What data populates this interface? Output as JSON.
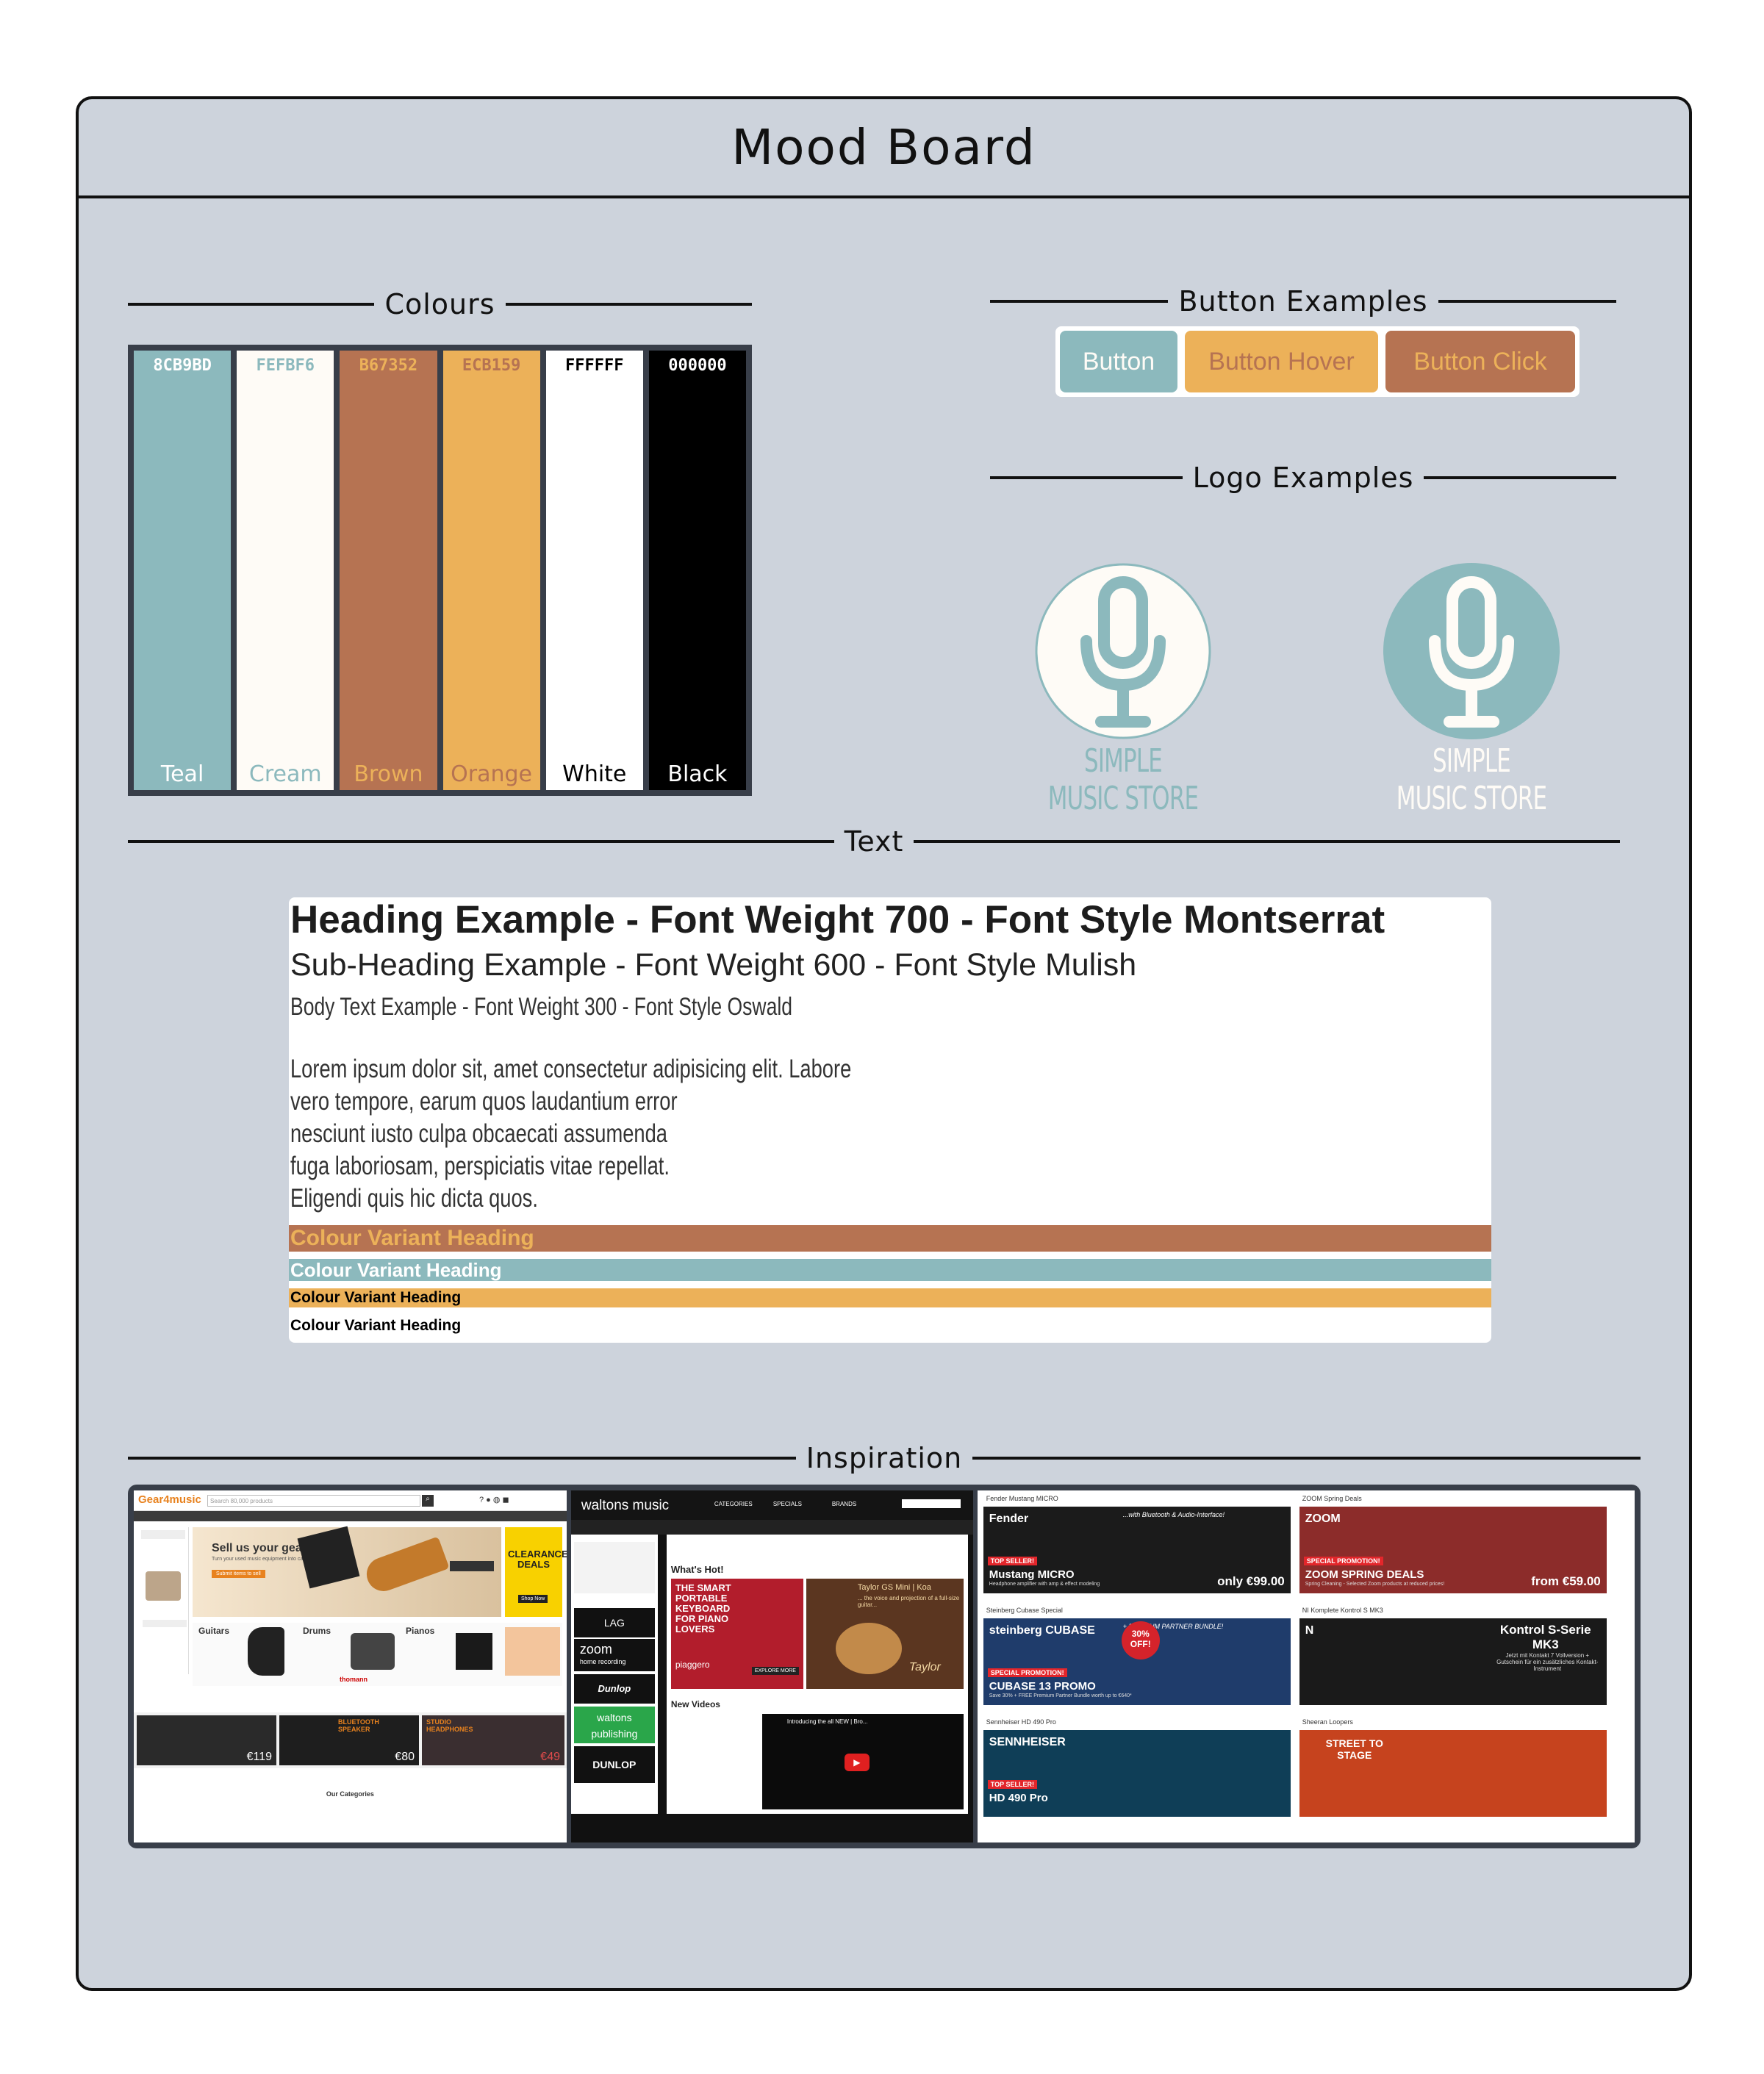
{
  "board_title": "Mood Board",
  "sections": {
    "colours": "Colours",
    "buttons": "Button Examples",
    "logos": "Logo Examples",
    "text": "Text",
    "inspiration": "Inspiration"
  },
  "palette": [
    {
      "hex": "8CB9BD",
      "name": "Teal",
      "fill": "#8cb9bd",
      "hex_color": "#ffffff",
      "name_color": "#ffffff"
    },
    {
      "hex": "FEFBF6",
      "name": "Cream",
      "fill": "#fefbf6",
      "hex_color": "#8cb9bd",
      "name_color": "#8cb9bd"
    },
    {
      "hex": "B67352",
      "name": "Brown",
      "fill": "#b67352",
      "hex_color": "#ecb159",
      "name_color": "#ecb159"
    },
    {
      "hex": "ECB159",
      "name": "Orange",
      "fill": "#ecb159",
      "hex_color": "#b67352",
      "name_color": "#b67352"
    },
    {
      "hex": "FFFFFF",
      "name": "White",
      "fill": "#ffffff",
      "hex_color": "#000000",
      "name_color": "#000000"
    },
    {
      "hex": "000000",
      "name": "Black",
      "fill": "#000000",
      "hex_color": "#ffffff",
      "name_color": "#ffffff"
    }
  ],
  "buttons": [
    {
      "label": "Button",
      "bg": "#8cb9bd",
      "fg": "#fefbf6"
    },
    {
      "label": "Button Hover",
      "bg": "#ecb159",
      "fg": "#b67352"
    },
    {
      "label": "Button Click",
      "bg": "#b67352",
      "fg": "#ecb159"
    }
  ],
  "logos": [
    {
      "text": "SIMPLE MUSIC STORE",
      "circle": "#fefbf6",
      "mic": "#8cb9bd",
      "text_color": "#8cb9bd"
    },
    {
      "text": "SIMPLE MUSIC STORE",
      "circle": "#8cb9bd",
      "mic": "#fefbf6",
      "text_color": "#fefbf6"
    }
  ],
  "text_samples": {
    "heading": "Heading Example - Font Weight 700 - Font Style Montserrat",
    "subheading": "Sub-Heading Example - Font Weight 600 - Font Style Mulish",
    "body": "Body Text Example - Font Weight 300 - Font Style Oswald",
    "lorem": [
      "Lorem ipsum dolor sit, amet consectetur adipisicing elit. Labore",
      "vero tempore, earum quos laudantium error",
      "nesciunt iusto culpa obcaecati assumenda",
      "fuga laboriosam, perspiciatis vitae repellat.",
      "Eligendi quis hic dicta quos."
    ],
    "variants": [
      {
        "text": "Colour Variant Heading",
        "bg": "#b67352",
        "fg": "#ecb159"
      },
      {
        "text": "Colour Variant Heading",
        "bg": "#8cb9bd",
        "fg": "#ffffff"
      },
      {
        "text": "Colour Variant Heading",
        "bg": "#ecb159",
        "fg": "#000000"
      },
      {
        "text": "Colour Variant Heading",
        "bg": "#ffffff",
        "fg": "#000000"
      }
    ]
  },
  "inspiration": {
    "gear4music": {
      "logo": "Gear4music",
      "search_placeholder": "Search 80,000 products",
      "hero_title": "Sell us your gear!",
      "hero_sub": "Turn your used music equipment into cash or credit",
      "hero_btn": "Submit items to sell",
      "clearance": "CLEARANCE DEALS",
      "shop_now": "Shop Now",
      "cats": [
        "Guitars",
        "Drums",
        "Pianos"
      ],
      "brand": "thomann",
      "promos": [
        {
          "title": "",
          "price": "€119"
        },
        {
          "title": "BLUETOOTH SPEAKER",
          "price": "€80"
        },
        {
          "title": "STUDIO HEADPHONES",
          "price": "€49"
        }
      ],
      "our_categories": "Our Categories"
    },
    "waltons": {
      "logo": "waltons music",
      "nav": [
        "CATEGORIES",
        "SPECIALS",
        "BRANDS"
      ],
      "whats_hot": "What's Hot!",
      "keyboard_title": "THE SMART PORTABLE KEYBOARD FOR PIANO LOVERS",
      "keyboard_brand": "piaggero",
      "guitar_title": "Taylor GS Mini | Koa",
      "guitar_sub": "... the voice and projection of a full-size guitar...",
      "guitar_brand": "Taylor",
      "new_videos": "New Videos",
      "video_title": "Introducing the all NEW | Bro...",
      "brands": [
        "zoom",
        "Dunlop",
        "waltons publishing",
        "DUNLOP"
      ],
      "zoom_sub": "home recording",
      "explore": "EXPLORE MORE"
    },
    "deals": [
      {
        "label": "Fender Mustang MICRO",
        "badge": "TOP SELLER!",
        "title": "Mustang MICRO",
        "sub": "Headphone amplifier with amp & effect modeling",
        "price": "only €99.00",
        "tag": "...with Bluetooth & Audio-Interface!",
        "brand": "Fender",
        "bg": "#1b1b1b"
      },
      {
        "label": "ZOOM Spring Deals",
        "badge": "SPECIAL PROMOTION!",
        "title": "ZOOM SPRING DEALS",
        "sub": "Spring Cleaning - Selected Zoom products at reduced prices!",
        "price": "from €59.00",
        "tag": "",
        "brand": "ZOOM",
        "bg": "#8c2c2a"
      },
      {
        "label": "Steinberg Cubase Special",
        "badge": "SPECIAL PROMOTION!",
        "title": "CUBASE 13 PROMO",
        "sub": "Save 30% + FREE Premium Partner Bundle worth up to €640*",
        "price": "",
        "tag": "+ PREMIUM PARTNER BUNDLE!",
        "brand": "steinberg CUBASE",
        "bg": "#1f3c6b",
        "discount": "30% OFF!"
      },
      {
        "label": "NI Komplete Kontrol S MK3",
        "badge": "",
        "title": "Kontrol S-Serie MK3",
        "sub": "Jetzt mit Kontakt 7 Vollversion + Gutschein für ein zusätzliches Kontakt-Instrument",
        "price": "",
        "tag": "",
        "brand": "N",
        "bg": "#1a1a1a"
      },
      {
        "label": "Sennheiser HD 490 Pro",
        "badge": "TOP SELLER!",
        "title": "HD 490 Pro",
        "sub": "",
        "price": "",
        "tag": "",
        "brand": "SENNHEISER",
        "bg": "#0f3e57"
      },
      {
        "label": "Sheeran Loopers",
        "badge": "",
        "title": "STREET TO STAGE",
        "sub": "",
        "price": "",
        "tag": "",
        "brand": "",
        "bg": "#c6431e"
      }
    ]
  }
}
